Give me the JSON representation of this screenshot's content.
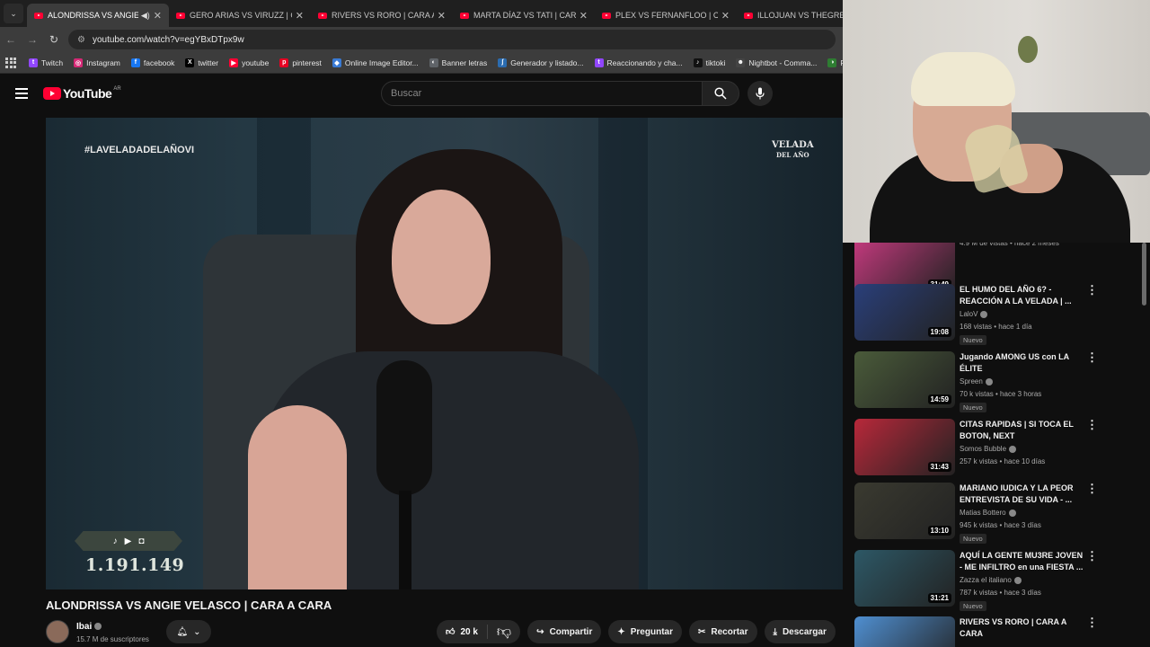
{
  "browser": {
    "tabs": [
      {
        "label": "ALONDRISSA VS ANGIE VE",
        "active": true
      },
      {
        "label": "GERO ARIAS VS VIRUZZ | CARA",
        "active": false
      },
      {
        "label": "RIVERS VS RORO | CARA A CAR",
        "active": false
      },
      {
        "label": "MARTA DÍAZ VS TATI | CARA A",
        "active": false
      },
      {
        "label": "PLEX VS FERNANFLOO | CARA",
        "active": false
      },
      {
        "label": "ILLOJUAN VS THEGREFG | CA",
        "active": false
      }
    ],
    "url": "youtube.com/watch?v=egYBxDTpx9w",
    "bookmarks": [
      {
        "label": "Twitch",
        "color": "#9146ff",
        "glyph": "t"
      },
      {
        "label": "Instagram",
        "color": "#d62976",
        "glyph": "◎"
      },
      {
        "label": "facebook",
        "color": "#1877f2",
        "glyph": "f"
      },
      {
        "label": "twitter",
        "color": "#000000",
        "glyph": "X"
      },
      {
        "label": "youtube",
        "color": "#ff0033",
        "glyph": "▶"
      },
      {
        "label": "pinterest",
        "color": "#e60023",
        "glyph": "p"
      },
      {
        "label": "Online Image Editor...",
        "color": "#3a7bd5",
        "glyph": "◆"
      },
      {
        "label": "Banner letras",
        "color": "#5f6368",
        "glyph": "◐"
      },
      {
        "label": "Generador y listado...",
        "color": "#2b6cb0",
        "glyph": "ʃ"
      },
      {
        "label": "Reaccionando y cha...",
        "color": "#9146ff",
        "glyph": "t"
      },
      {
        "label": "tiktoki",
        "color": "#111111",
        "glyph": "♪"
      },
      {
        "label": "Nightbot - Comma...",
        "color": "#444444",
        "glyph": "☻"
      },
      {
        "label": "Fútbol",
        "color": "#2e7d32",
        "glyph": "◑"
      }
    ]
  },
  "youtube": {
    "logo_word": "YouTube",
    "country": "AR",
    "search_placeholder": "Buscar"
  },
  "video": {
    "hashtag": "#LAVELADADELAÑOVI",
    "brand_top": "VELADA",
    "brand_bottom": "DEL AÑO",
    "overlay_views": "1.191.149",
    "title": "ALONDRISSA VS ANGIE VELASCO | CARA A CARA",
    "channel": "Ibai",
    "subscribers": "15.7 M de suscriptores",
    "likes": "20 k",
    "share_label": "Compartir",
    "ask_label": "Preguntar",
    "clip_label": "Recortar",
    "download_label": "Descargar"
  },
  "recommendations": [
    {
      "title": "",
      "channel": "",
      "meta": "4.9 M de vistas • hace 2 meses",
      "duration": "31:49",
      "nuevo": "",
      "thumb": "#c63a7f"
    },
    {
      "title": "EL HUMO DEL AÑO 6? - REACCIÓN A LA VELADA | ...",
      "channel": "LaloV",
      "meta": "168 vistas • hace 1 día",
      "duration": "19:08",
      "nuevo": "Nuevo",
      "thumb": "#2a3f7a"
    },
    {
      "title": "Jugando AMONG US con LA ÉLITE",
      "channel": "Spreen",
      "meta": "70 k vistas • hace 3 horas",
      "duration": "14:59",
      "nuevo": "Nuevo",
      "thumb": "#4a5b3a"
    },
    {
      "title": "CITAS RAPIDAS | SI TOCA EL BOTON, NEXT",
      "channel": "Somos Bubble",
      "meta": "257 k vistas • hace 10 días",
      "duration": "31:43",
      "nuevo": "",
      "thumb": "#b8283a"
    },
    {
      "title": "MARIANO IUDICA Y LA PEOR ENTREVISTA DE SU VIDA - ...",
      "channel": "Matias Bottero",
      "meta": "945 k vistas • hace 3 días",
      "duration": "13:10",
      "nuevo": "Nuevo",
      "thumb": "#3a3a30"
    },
    {
      "title": "AQUÍ LA GENTE MU3RE JOVEN - ME INFILTRO en una FIESTA ...",
      "channel": "Zazza el italiano",
      "meta": "787 k vistas • hace 3 días",
      "duration": "31:21",
      "nuevo": "Nuevo",
      "thumb": "#2d5866"
    },
    {
      "title": "RIVERS VS RORO | CARA A CARA",
      "channel": "",
      "meta": "",
      "duration": "",
      "nuevo": "",
      "thumb": "#4f8fd1"
    }
  ]
}
